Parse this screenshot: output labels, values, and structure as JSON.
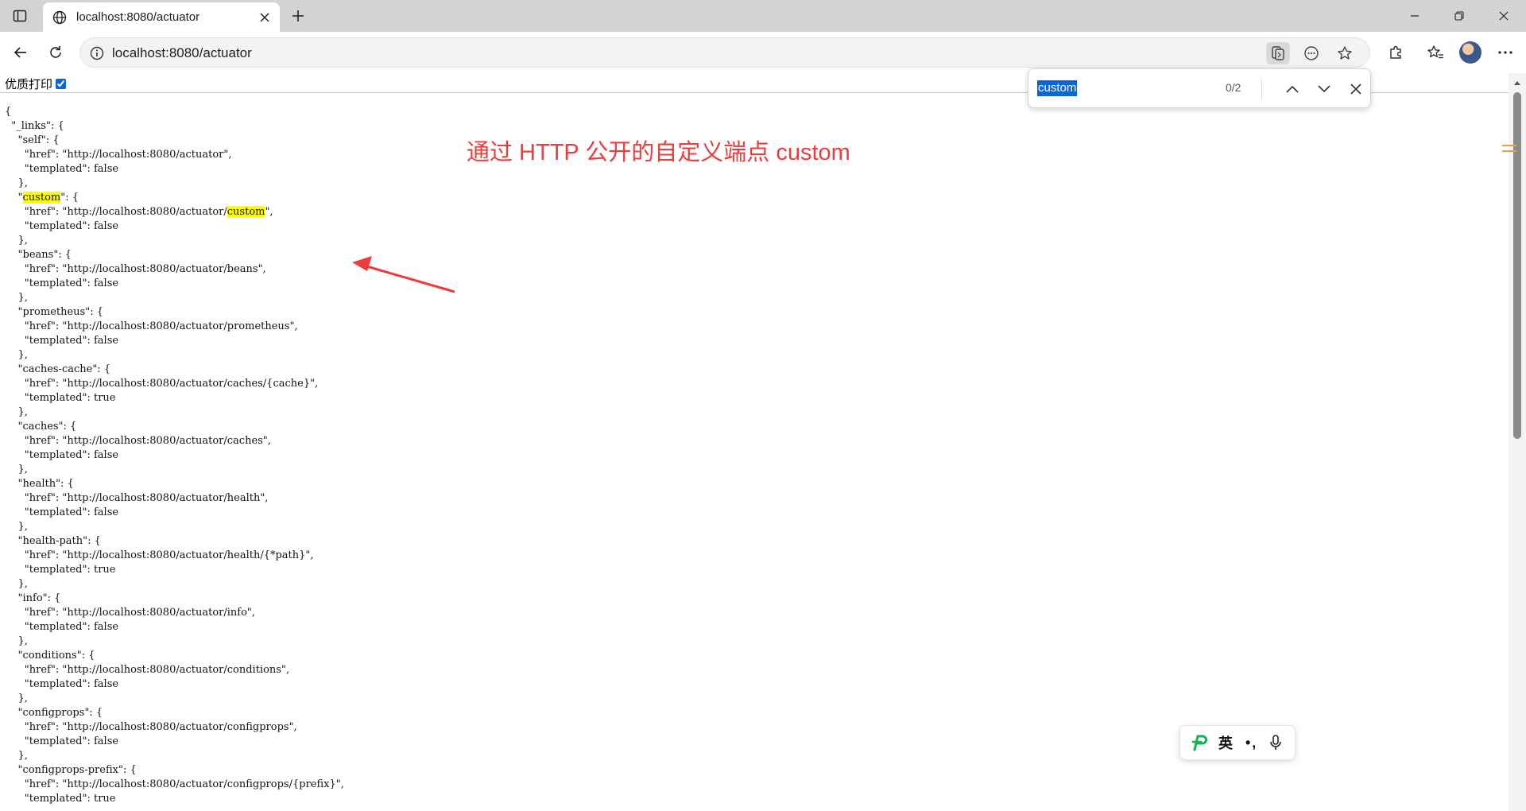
{
  "browser": {
    "tab_title": "localhost:8080/actuator",
    "url": "localhost:8080/actuator"
  },
  "page": {
    "pretty_print_label": "优质打印",
    "json_pre": "{\n  \"_links\": {\n    \"self\": {\n      \"href\": \"http://localhost:8080/actuator\",\n      \"templated\": false\n    },\n    \"",
    "json_hl1": "custom",
    "json_mid": "\": {\n      \"href\": \"http://localhost:8080/actuator/",
    "json_hl2": "custom",
    "json_rest": "\",\n      \"templated\": false\n    },\n    \"beans\": {\n      \"href\": \"http://localhost:8080/actuator/beans\",\n      \"templated\": false\n    },\n    \"prometheus\": {\n      \"href\": \"http://localhost:8080/actuator/prometheus\",\n      \"templated\": false\n    },\n    \"caches-cache\": {\n      \"href\": \"http://localhost:8080/actuator/caches/{cache}\",\n      \"templated\": true\n    },\n    \"caches\": {\n      \"href\": \"http://localhost:8080/actuator/caches\",\n      \"templated\": false\n    },\n    \"health\": {\n      \"href\": \"http://localhost:8080/actuator/health\",\n      \"templated\": false\n    },\n    \"health-path\": {\n      \"href\": \"http://localhost:8080/actuator/health/{*path}\",\n      \"templated\": true\n    },\n    \"info\": {\n      \"href\": \"http://localhost:8080/actuator/info\",\n      \"templated\": false\n    },\n    \"conditions\": {\n      \"href\": \"http://localhost:8080/actuator/conditions\",\n      \"templated\": false\n    },\n    \"configprops\": {\n      \"href\": \"http://localhost:8080/actuator/configprops\",\n      \"templated\": false\n    },\n    \"configprops-prefix\": {\n      \"href\": \"http://localhost:8080/actuator/configprops/{prefix}\",\n      \"templated\": true",
    "annotation": "通过 HTTP 公开的自定义端点 custom"
  },
  "find": {
    "query": "custom",
    "count": "0/2"
  },
  "ime": {
    "lang": "英",
    "punct": "•,"
  },
  "colors": {
    "highlight": "#ffff00",
    "annotation_red": "#ee3c3c",
    "selection_blue": "#0a66d6"
  }
}
